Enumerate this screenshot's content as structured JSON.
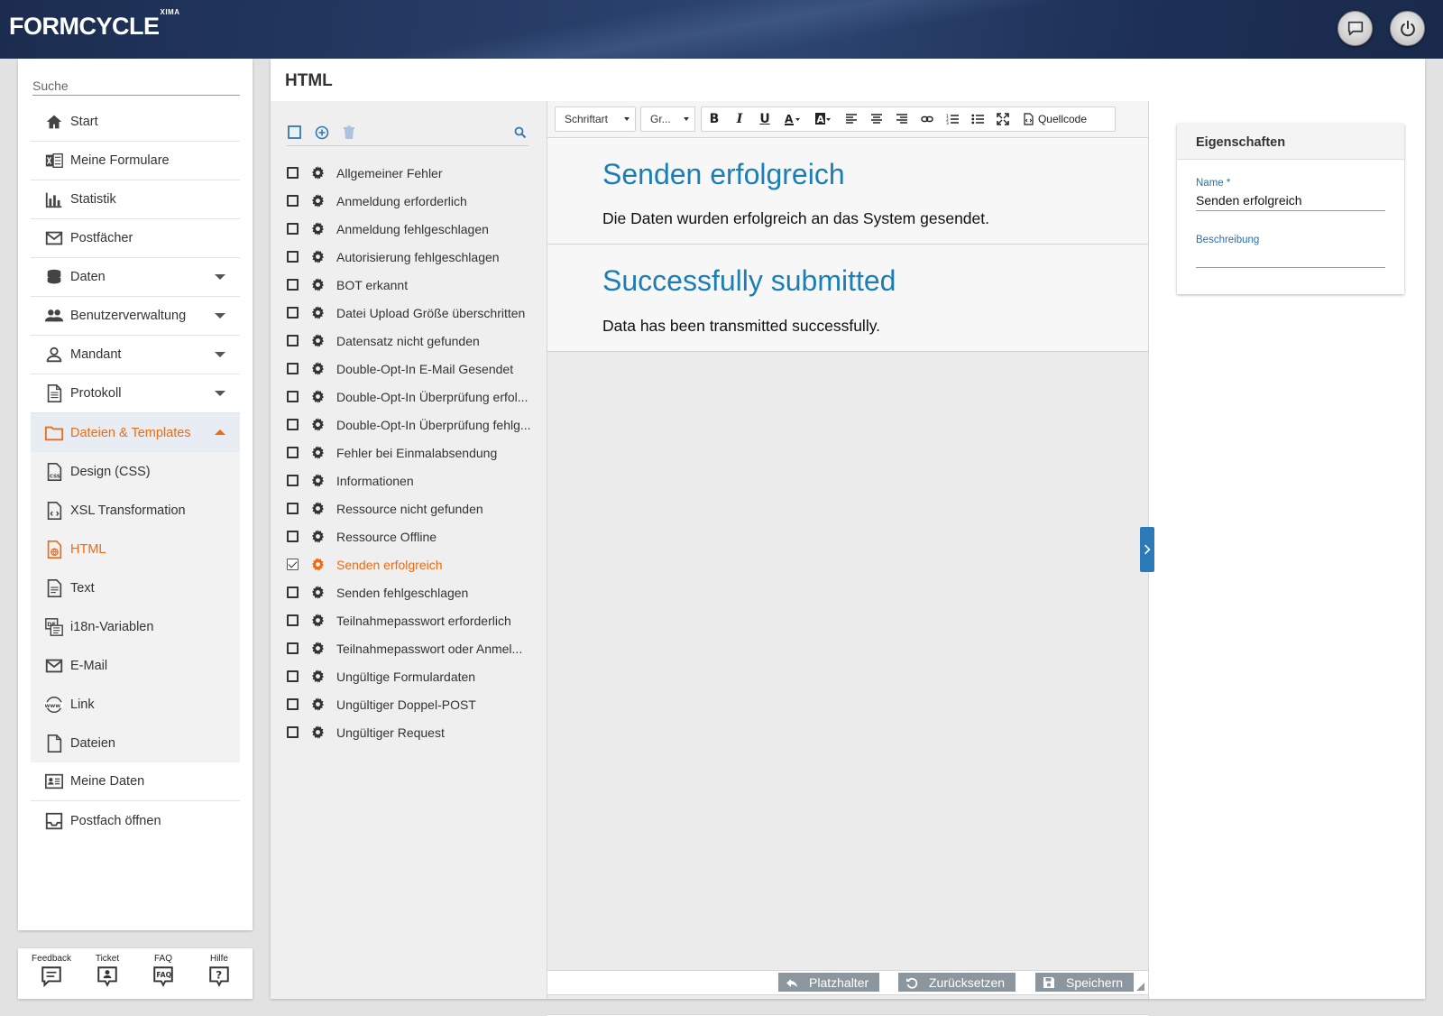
{
  "header": {
    "logo": "FORMCYCLE",
    "logo_sup": "XIMA",
    "chat_icon": "chat-icon",
    "power_icon": "power-icon"
  },
  "sidebar": {
    "search_placeholder": "Suche",
    "items": [
      {
        "label": "Start",
        "icon": "home-icon"
      },
      {
        "label": "Meine Formulare",
        "icon": "forms-icon"
      },
      {
        "label": "Statistik",
        "icon": "bar-chart-icon"
      },
      {
        "label": "Postfächer",
        "icon": "mail-icon"
      },
      {
        "label": "Daten",
        "icon": "database-icon"
      },
      {
        "label": "Benutzerverwaltung",
        "icon": "users-icon"
      },
      {
        "label": "Mandant",
        "icon": "person-icon"
      },
      {
        "label": "Protokoll",
        "icon": "document-icon"
      },
      {
        "label": "Dateien & Templates",
        "icon": "folder-icon"
      },
      {
        "label": "Design (CSS)",
        "icon": "css-file-icon"
      },
      {
        "label": "XSL Transformation",
        "icon": "code-file-icon"
      },
      {
        "label": "HTML",
        "icon": "html-file-icon"
      },
      {
        "label": "Text",
        "icon": "text-file-icon"
      },
      {
        "label": "i18n-Variablen",
        "icon": "language-icon"
      },
      {
        "label": "E-Mail",
        "icon": "mail-icon"
      },
      {
        "label": "Link",
        "icon": "www-icon"
      },
      {
        "label": "Dateien",
        "icon": "file-icon"
      },
      {
        "label": "Meine Daten",
        "icon": "id-card-icon"
      },
      {
        "label": "Postfach öffnen",
        "icon": "inbox-icon"
      }
    ]
  },
  "helpbar": {
    "items": [
      {
        "label": "Feedback"
      },
      {
        "label": "Ticket"
      },
      {
        "label": "FAQ"
      },
      {
        "label": "Hilfe"
      }
    ]
  },
  "page": {
    "title": "HTML"
  },
  "template_list": {
    "items": [
      "Allgemeiner Fehler",
      "Anmeldung erforderlich",
      "Anmeldung fehlgeschlagen",
      "Autorisierung fehlgeschlagen",
      "BOT erkannt",
      "Datei Upload Größe überschritten",
      "Datensatz nicht gefunden",
      "Double-Opt-In E-Mail Gesendet",
      "Double-Opt-In Überprüfung erfol...",
      "Double-Opt-In Überprüfung fehlg...",
      "Fehler bei Einmalabsendung",
      "Informationen",
      "Ressource nicht gefunden",
      "Ressource Offline",
      "Senden erfolgreich",
      "Senden fehlgeschlagen",
      "Teilnahmepasswort erforderlich",
      "Teilnahmepasswort oder Anmel...",
      "Ungültige Formulardaten",
      "Ungültiger Doppel-POST",
      "Ungültiger Request"
    ],
    "selected": "Senden erfolgreich"
  },
  "editor": {
    "font_combo": "Schriftart",
    "size_combo": "Gr...",
    "source_label": "Quellcode",
    "blocks": [
      {
        "heading": "Senden erfolgreich",
        "text": "Die Daten wurden erfolgreich an das System gesendet."
      },
      {
        "heading": "Successfully submitted",
        "text": "Data has been transmitted successfully."
      }
    ],
    "buttons": {
      "placeholder": "Platzhalter",
      "reset": "Zurücksetzen",
      "save": "Speichern"
    }
  },
  "properties": {
    "title": "Eigenschaften",
    "name_label": "Name *",
    "name_value": "Senden erfolgreich",
    "description_label": "Beschreibung",
    "description_value": ""
  },
  "colors": {
    "accent": "#f06a13",
    "heading_blue": "#1a7fb4",
    "button_gray": "#8b969e"
  }
}
